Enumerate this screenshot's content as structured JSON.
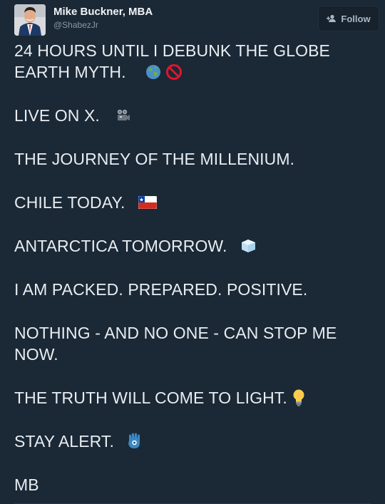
{
  "user": {
    "display_name": "Mike Buckner, MBA",
    "handle": "@ShabezJr"
  },
  "follow_button": {
    "label": "Follow",
    "icon": "add-user-icon"
  },
  "tweet": {
    "lines": [
      "24 HOURS UNTIL I DEBUNK THE GLOBE",
      "EARTH MYTH.",
      "LIVE ON X.",
      "THE JOURNEY OF THE MILLENIUM.",
      "CHILE TODAY.",
      "ANTARCTICA TOMORROW.",
      "I AM PACKED. PREPARED. POSITIVE.",
      "NOTHING - AND NO ONE - CAN STOP ME",
      "NOW.",
      "THE TRUTH WILL COME TO LIGHT.",
      "STAY ALERT.",
      "MB"
    ],
    "emojis": {
      "line2": [
        "globe-icon",
        "prohibited-icon"
      ],
      "line3": "video-camera-icon",
      "line5": "chile-flag-icon",
      "line6": "ice-cube-icon",
      "line10": "light-bulb-icon",
      "line11": "hamsa-icon"
    }
  },
  "colors": {
    "background": "#1b2836",
    "text": "#e8edf1",
    "secondary_text": "#8899a6"
  }
}
